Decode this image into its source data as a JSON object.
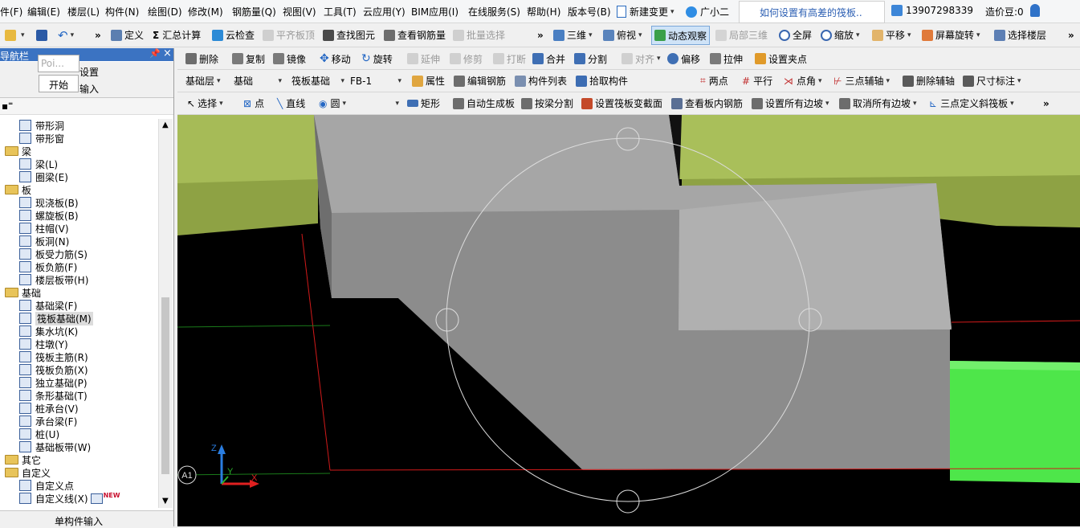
{
  "menu": [
    "件(F)",
    "编辑(E)",
    "楼层(L)",
    "构件(N)",
    "绘图(D)",
    "修改(M)",
    "钢筋量(Q)",
    "视图(V)",
    "工具(T)",
    "云应用(Y)",
    "BIM应用(I)",
    "在线服务(S)",
    "帮助(H)",
    "版本号(B)"
  ],
  "menu_extra": {
    "new_change": "新建变更",
    "assistant": "广小二",
    "search_text": "如何设置有高差的筏板..",
    "phone": "13907298339",
    "beans": "造价豆:0"
  },
  "toolbar1": {
    "define": "定义",
    "calc": "汇总计算",
    "cloud_check": "云检查",
    "align_top": "平齐板顶",
    "find": "查找图元",
    "view_rebar": "查看钢筋量",
    "batch": "批量选择",
    "view3d": "三维",
    "top_view": "俯视",
    "dynamic": "动态观察",
    "local3d": "局部三维",
    "fullscreen": "全屏",
    "zoom": "缩放",
    "pan": "平移",
    "rotate": "屏幕旋转",
    "select_floor": "选择楼层"
  },
  "toolbar2": {
    "delete": "删除",
    "copy": "复制",
    "mirror": "镜像",
    "move": "移动",
    "rotate": "旋转",
    "extend": "延伸",
    "trim": "修剪",
    "break": "打断",
    "merge": "合并",
    "split": "分割",
    "align": "对齐",
    "offset": "偏移",
    "stretch": "拉伸",
    "set_grip": "设置夹点"
  },
  "toolbar3": {
    "floor": "基础层",
    "category": "基础",
    "type": "筏板基础",
    "member": "FB-1",
    "props": "属性",
    "edit_rebar": "编辑钢筋",
    "member_list": "构件列表",
    "pick": "拾取构件",
    "two_points": "两点",
    "parallel": "平行",
    "point_angle": "点角",
    "three_point_axis": "三点辅轴",
    "del_axis": "删除辅轴",
    "dimension": "尺寸标注"
  },
  "toolbar4": {
    "select": "选择",
    "point": "点",
    "line": "直线",
    "circle": "圆",
    "rect": "矩形",
    "auto_gen": "自动生成板",
    "split_by_beam": "按梁分割",
    "set_section": "设置筏板变截面",
    "view_inner_rebar": "查看板内钢筋",
    "set_slopes": "设置所有边坡",
    "cancel_slopes": "取消所有边坡",
    "three_point_slope": "三点定义斜筏板"
  },
  "nav": {
    "title": "导航栏",
    "popup_input": "Poi...",
    "popup_start": "开始",
    "tab_settings": "设置",
    "tab_input": "输入",
    "bottom": "单构件输入"
  },
  "tree": [
    {
      "label": "带形洞",
      "level": 1
    },
    {
      "label": "带形窗",
      "level": 1
    },
    {
      "label": "梁",
      "level": 0
    },
    {
      "label": "梁(L)",
      "level": 1
    },
    {
      "label": "圈梁(E)",
      "level": 1
    },
    {
      "label": "板",
      "level": 0
    },
    {
      "label": "现浇板(B)",
      "level": 1
    },
    {
      "label": "螺旋板(B)",
      "level": 1
    },
    {
      "label": "柱帽(V)",
      "level": 1
    },
    {
      "label": "板洞(N)",
      "level": 1
    },
    {
      "label": "板受力筋(S)",
      "level": 1
    },
    {
      "label": "板负筋(F)",
      "level": 1
    },
    {
      "label": "楼层板带(H)",
      "level": 1
    },
    {
      "label": "基础",
      "level": 0
    },
    {
      "label": "基础梁(F)",
      "level": 1
    },
    {
      "label": "筏板基础(M)",
      "level": 1,
      "selected": true
    },
    {
      "label": "集水坑(K)",
      "level": 1
    },
    {
      "label": "柱墩(Y)",
      "level": 1
    },
    {
      "label": "筏板主筋(R)",
      "level": 1
    },
    {
      "label": "筏板负筋(X)",
      "level": 1
    },
    {
      "label": "独立基础(P)",
      "level": 1
    },
    {
      "label": "条形基础(T)",
      "level": 1
    },
    {
      "label": "桩承台(V)",
      "level": 1
    },
    {
      "label": "承台梁(F)",
      "level": 1
    },
    {
      "label": "桩(U)",
      "level": 1
    },
    {
      "label": "基础板带(W)",
      "level": 1
    },
    {
      "label": "其它",
      "level": 0
    },
    {
      "label": "自定义",
      "level": 0
    },
    {
      "label": "自定义点",
      "level": 1
    },
    {
      "label": "自定义线(X)",
      "level": 1,
      "badge": "NEW"
    }
  ],
  "viewport": {
    "axis_label": "A1",
    "z": "Z",
    "y": "Y",
    "x": "X"
  },
  "colors": {
    "accent": "#1e73c8",
    "highlight_green": "#4ee64a",
    "slab_olive": "#8ea244",
    "grid_red": "#d11a1a"
  }
}
